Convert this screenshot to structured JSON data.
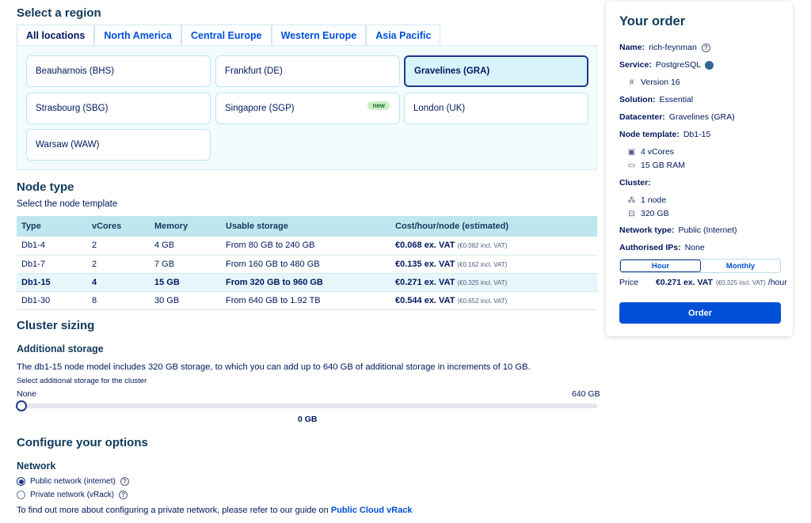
{
  "region": {
    "title": "Select a region",
    "tabs": [
      "All locations",
      "North America",
      "Central Europe",
      "Western Europe",
      "Asia Pacific"
    ],
    "active_tab": "All locations",
    "locations": [
      {
        "label": "Beauharnois (BHS)"
      },
      {
        "label": "Frankfurt (DE)"
      },
      {
        "label": "Gravelines (GRA)",
        "selected": true
      },
      {
        "label": "Strasbourg (SBG)"
      },
      {
        "label": "Singapore (SGP)",
        "badge": "new"
      },
      {
        "label": "London (UK)"
      },
      {
        "label": "Warsaw (WAW)"
      }
    ]
  },
  "node": {
    "title": "Node type",
    "subtitle": "Select the node template",
    "headers": [
      "Type",
      "vCores",
      "Memory",
      "Usable storage",
      "Cost/hour/node (estimated)"
    ],
    "rows": [
      {
        "type": "Db1-4",
        "vcores": "2",
        "memory": "4 GB",
        "storage": "From 80 GB to 240 GB",
        "cost": "€0.068 ex. VAT",
        "cost_incl": "(€0.082 incl. VAT)"
      },
      {
        "type": "Db1-7",
        "vcores": "2",
        "memory": "7 GB",
        "storage": "From 160 GB to 480 GB",
        "cost": "€0.135 ex. VAT",
        "cost_incl": "(€0.162 incl. VAT)"
      },
      {
        "type": "Db1-15",
        "vcores": "4",
        "memory": "15 GB",
        "storage": "From 320 GB to 960 GB",
        "cost": "€0.271 ex. VAT",
        "cost_incl": "(€0.325 incl. VAT)",
        "selected": true
      },
      {
        "type": "Db1-30",
        "vcores": "8",
        "memory": "30 GB",
        "storage": "From 640 GB to 1.92 TB",
        "cost": "€0.544 ex. VAT",
        "cost_incl": "(€0.652 incl. VAT)"
      }
    ]
  },
  "cluster": {
    "title": "Cluster sizing",
    "storage_title": "Additional storage",
    "storage_desc": "The db1-15 node model includes 320 GB storage, to which you can add up to 640 GB of additional storage in increments of 10 GB.",
    "select_label": "Select additional storage for the cluster",
    "slider_min": "None",
    "slider_max": "640 GB",
    "slider_value": "0 GB",
    "slider_fraction": 0
  },
  "options": {
    "title": "Configure your options",
    "network_title": "Network",
    "public_label": "Public network (internet)",
    "private_label": "Private network (vRack)",
    "guide_text": "To find out more about configuring a private network, please refer to our guide on ",
    "guide_link": "Public Cloud vRack"
  },
  "order": {
    "title": "Your order",
    "name_label": "Name:",
    "name_value": "rich-feynman",
    "service_label": "Service:",
    "service_value": "PostgreSQL",
    "version": "Version 16",
    "solution_label": "Solution:",
    "solution_value": "Essential",
    "datacenter_label": "Datacenter:",
    "datacenter_value": "Gravelines (GRA)",
    "template_label": "Node template:",
    "template_value": "Db1-15",
    "vcores": "4 vCores",
    "ram": "15 GB RAM",
    "cluster_label": "Cluster:",
    "nodes": "1 node",
    "cluster_storage": "320 GB",
    "network_label": "Network type:",
    "network_value": "Public (Internet)",
    "ips_label": "Authorised IPs:",
    "ips_value": "None",
    "toggle_hour": "Hour",
    "toggle_monthly": "Monthly",
    "price_label": "Price",
    "price_value": "€0.271 ex. VAT",
    "price_incl": "(€0.325 incl. VAT)",
    "price_unit": "/hour",
    "order_button": "Order"
  },
  "colors": {
    "accent": "#0050d7",
    "selected_bg": "#d8f3fb",
    "header_bg": "#bfe6ef"
  }
}
